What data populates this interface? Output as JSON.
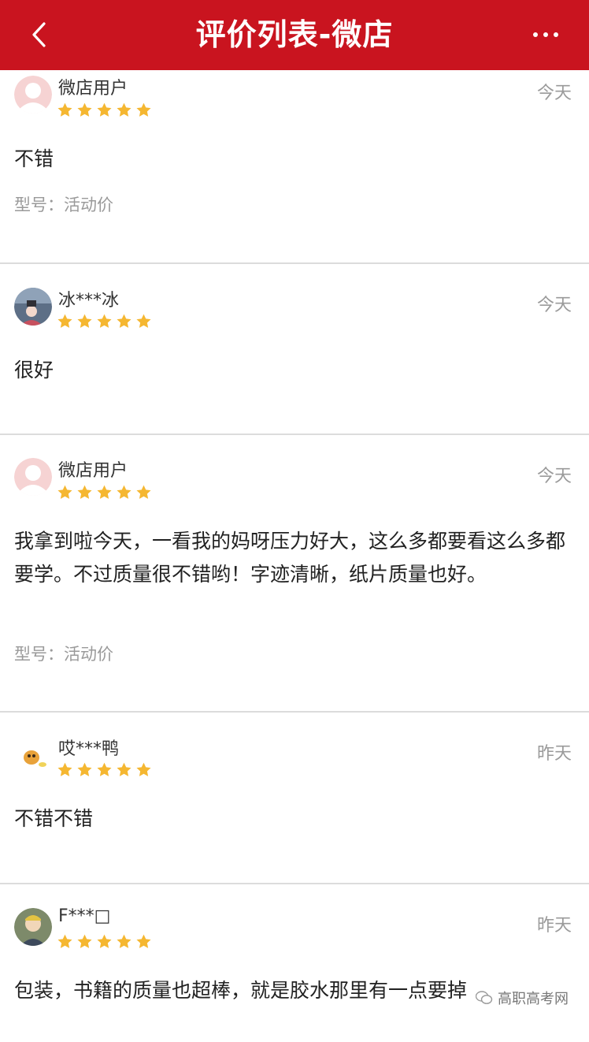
{
  "header": {
    "title": "评价列表-微店",
    "back_icon": "chevron-left-icon",
    "more_icon": "ellipsis-icon",
    "background_color": "#c9141f"
  },
  "star_color": "#f5b731",
  "rating_max": 5,
  "reviews": [
    {
      "user": "微店用户",
      "rating": 5,
      "date": "今天",
      "content": "不错",
      "model": "型号：活动价",
      "avatar": "default-avatar-icon"
    },
    {
      "user": "冰***冰",
      "rating": 5,
      "date": "今天",
      "content": "很好",
      "model": "",
      "avatar": "photo-avatar"
    },
    {
      "user": "微店用户",
      "rating": 5,
      "date": "今天",
      "content": "我拿到啦今天，一看我的妈呀压力好大，这么多都要看这么多都要学。不过质量很不错哟！字迹清晰，纸片质量也好。",
      "model": "型号：活动价",
      "avatar": "default-avatar-icon"
    },
    {
      "user": "哎***鸭",
      "rating": 5,
      "date": "昨天",
      "content": "不错不错",
      "model": "",
      "avatar": "cartoon-avatar"
    },
    {
      "user": "F***□",
      "rating": 5,
      "date": "昨天",
      "content": "包装，书籍的质量也超棒，就是胶水那里有一点要掉",
      "model": "",
      "avatar": "photo-avatar"
    }
  ],
  "watermark": {
    "text": "高职高考网",
    "icon": "wechat-icon"
  }
}
